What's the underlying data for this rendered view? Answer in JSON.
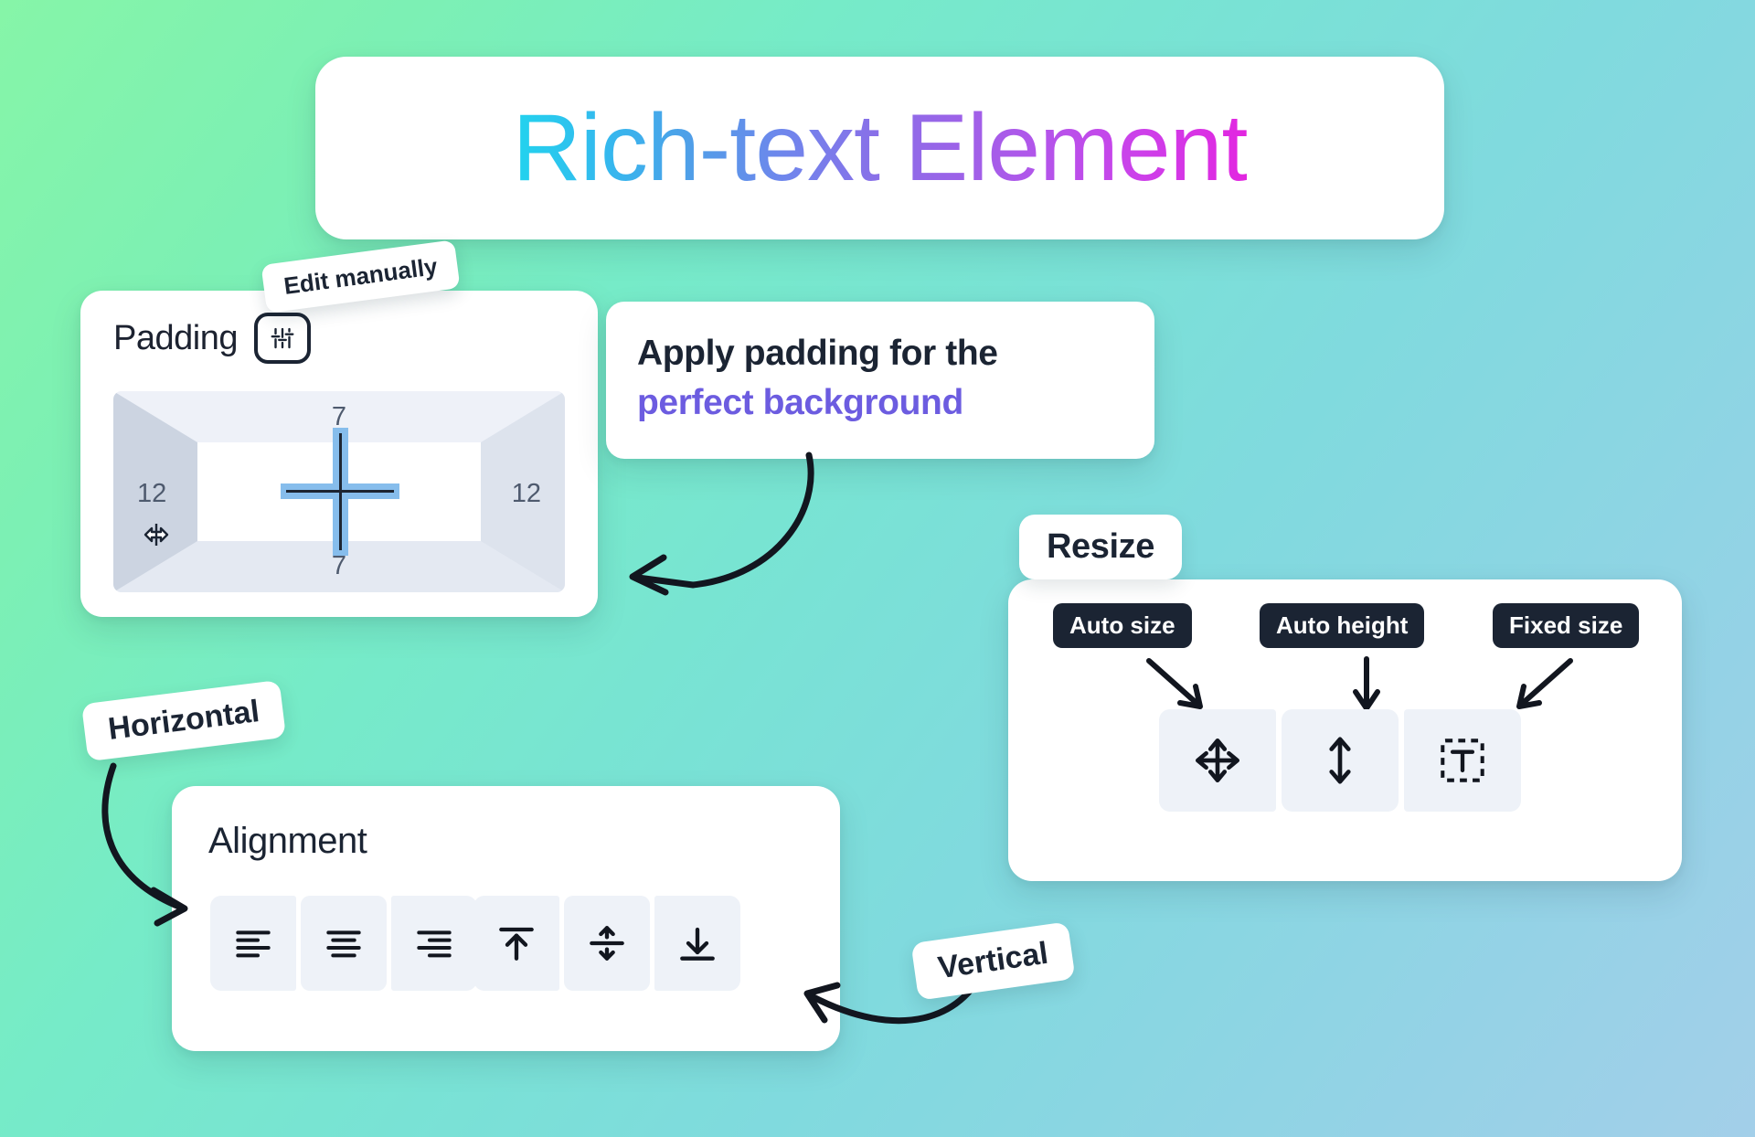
{
  "title": {
    "text": "Rich-text Element"
  },
  "padding_panel": {
    "label": "Padding",
    "settings_icon": "sliders-icon",
    "edit_manually_badge": "Edit manually",
    "values": {
      "top": "7",
      "right": "12",
      "bottom": "7",
      "left": "12"
    },
    "cursor_icon": "horizontal-resize-cursor-icon",
    "crosshair_icon": "crosshair-icon"
  },
  "apply_callout": {
    "line1": "Apply padding for the",
    "line2": "perfect background",
    "line1_color": "#1b2433",
    "line2_color": "#6c5ce0"
  },
  "resize_panel": {
    "badge": "Resize",
    "tooltips": [
      {
        "label": "Auto size",
        "icon": "move-four-arrows-icon"
      },
      {
        "label": "Auto height",
        "icon": "vertical-double-arrow-icon"
      },
      {
        "label": "Fixed size",
        "icon": "fixed-text-box-icon"
      }
    ]
  },
  "alignment_panel": {
    "title": "Alignment",
    "horizontal_badge": "Horizontal",
    "vertical_badge": "Vertical",
    "horizontal_options": [
      {
        "icon": "align-left-icon"
      },
      {
        "icon": "align-center-icon"
      },
      {
        "icon": "align-right-icon"
      }
    ],
    "vertical_options": [
      {
        "icon": "align-top-icon"
      },
      {
        "icon": "align-middle-icon"
      },
      {
        "icon": "align-bottom-icon"
      }
    ]
  },
  "theme": {
    "background_start": "#86f5a8",
    "background_mid": "#79e2d5",
    "background_end": "#a3cfe9",
    "card_bg": "#ffffff",
    "dark": "#1b2433",
    "accent_purple": "#6c5ce0",
    "control_bg": "#eef2f8",
    "pad_blue": "#86bdec"
  }
}
